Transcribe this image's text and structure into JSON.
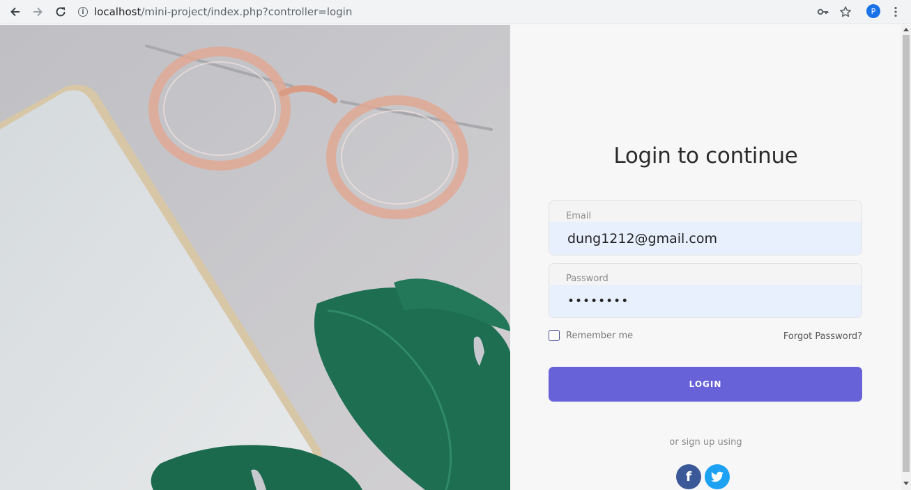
{
  "browser": {
    "url_host": "localhost",
    "url_path": "/mini-project/index.php?controller=login",
    "profile_initial": "P",
    "icons": [
      "back-icon",
      "forward-icon",
      "reload-icon",
      "info-icon",
      "key-icon",
      "star-icon",
      "more-vert-icon"
    ]
  },
  "login": {
    "title": "Login to continue",
    "email_label": "Email",
    "email_value": "dung1212@gmail.com",
    "password_label": "Password",
    "password_value": "••••••••",
    "remember_label": "Remember me",
    "forgot_label": "Forgot Password?",
    "login_button": "LOGIN",
    "signup_text": "or sign up using",
    "facebook_glyph": "f"
  },
  "colors": {
    "accent": "#6762d8",
    "autofill": "#e8f0fe",
    "facebook": "#3b5998",
    "twitter": "#1da1f2"
  }
}
